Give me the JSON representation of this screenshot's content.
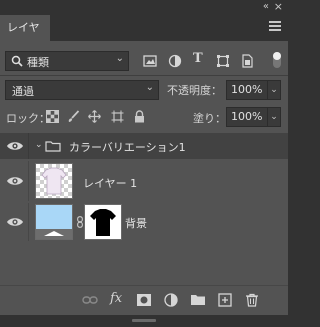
{
  "panel": {
    "title": "レイヤー",
    "collapse_glyph": "«",
    "close_glyph": "×",
    "menu_icon": "hamburger-icon"
  },
  "filter": {
    "kind_value": "種類",
    "icons": [
      "image-filter-icon",
      "adjustment-filter-icon",
      "type-filter-icon",
      "shape-filter-icon",
      "smart-object-filter-icon"
    ],
    "type_glyph": "T"
  },
  "blend": {
    "mode_value": "通過",
    "opacity_label": "不透明度：",
    "opacity_value": "100%"
  },
  "lock": {
    "label": "ロック：",
    "icons": [
      "lock-transparent-icon",
      "lock-image-icon",
      "lock-position-icon",
      "lock-artboard-icon",
      "lock-all-icon"
    ],
    "fill_label": "塗り：",
    "fill_value": "100%"
  },
  "layers": [
    {
      "name": "カラーバリエーション1",
      "kind": "group",
      "visible": true
    },
    {
      "name": "レイヤー 1",
      "kind": "pixel",
      "visible": true
    },
    {
      "name": "背景",
      "kind": "background-with-mask",
      "visible": true
    }
  ],
  "bottom_toolbar": {
    "icons": [
      "link-layers-icon",
      "fx-icon",
      "add-mask-icon",
      "adjustment-layer-icon",
      "new-group-icon",
      "new-layer-icon",
      "delete-icon"
    ],
    "fx_label": "fx"
  }
}
